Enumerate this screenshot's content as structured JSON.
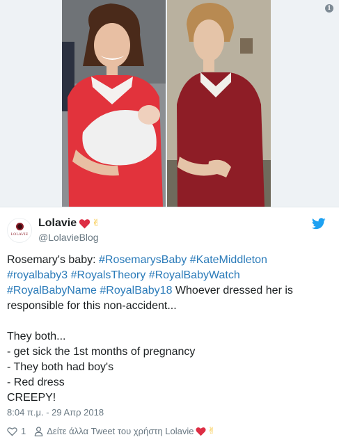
{
  "author": {
    "display_name": "Lolavie",
    "handle": "@LolavieBlog",
    "avatar_text": "LOLAVIE"
  },
  "tweet": {
    "line1_prefix": "Rosemary's baby: ",
    "hashtags_line1": [
      "#RosemarysBaby",
      "#KateMiddleton"
    ],
    "hashtags_line2": [
      "#royalbaby3",
      "#RoyalsTheory",
      "#RoyalBabyWatch"
    ],
    "hashtags_line3": [
      "#RoyalBabyName",
      "#RoyalBaby18"
    ],
    "line3_suffix": " Whoever dressed her is",
    "line4": "responsible for this non-accident...",
    "line5": "They both...",
    "line6": "- get sick the 1st months of pregnancy",
    "line7": "- They both had boy's",
    "line8": "- Red dress",
    "line9": "CREEPY!"
  },
  "timestamp": "8:04 π.μ. - 29 Απρ 2018",
  "actions": {
    "like_count": "1",
    "more_tweets_label": "Δείτε άλλα Tweet του χρήστη Lolavie"
  },
  "icons": {
    "info": "info-icon",
    "twitter": "twitter-bird-icon",
    "like": "heart-outline-icon",
    "user": "user-icon"
  },
  "colors": {
    "link": "#2b7bb9",
    "muted": "#697882",
    "twitter_blue": "#1da1f2",
    "heart_red": "#e0245e"
  }
}
